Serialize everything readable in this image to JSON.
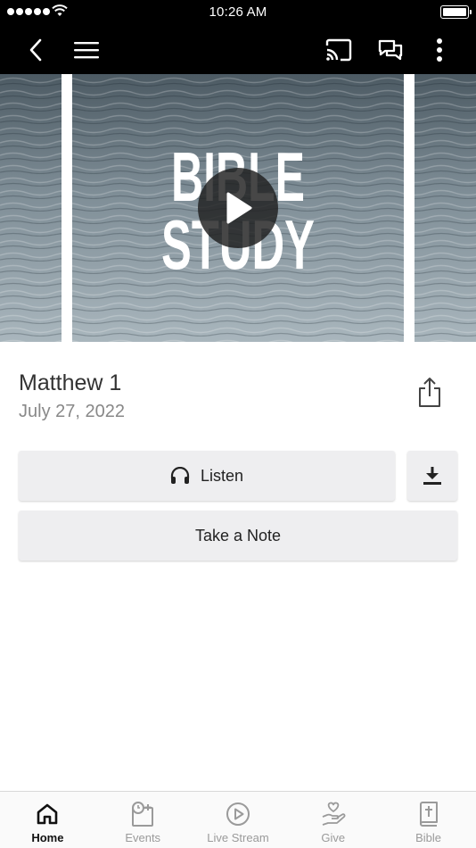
{
  "status_bar": {
    "time": "10:26 AM"
  },
  "media": {
    "title": "Matthew 1",
    "date": "July 27, 2022",
    "artwork_text": [
      "BIBLE",
      "STUDY"
    ]
  },
  "actions": {
    "listen_label": "Listen",
    "note_label": "Take a Note"
  },
  "tabs": [
    {
      "label": "Home",
      "icon": "home-icon",
      "active": true
    },
    {
      "label": "Events",
      "icon": "events-icon",
      "active": false
    },
    {
      "label": "Live Stream",
      "icon": "live-stream-icon",
      "active": false
    },
    {
      "label": "Give",
      "icon": "give-icon",
      "active": false
    },
    {
      "label": "Bible",
      "icon": "bible-icon",
      "active": false
    }
  ],
  "colors": {
    "bar": "#000000",
    "button_bg": "#eeeef0",
    "active_tab": "#111111",
    "inactive_tab": "#9a9a9a"
  }
}
